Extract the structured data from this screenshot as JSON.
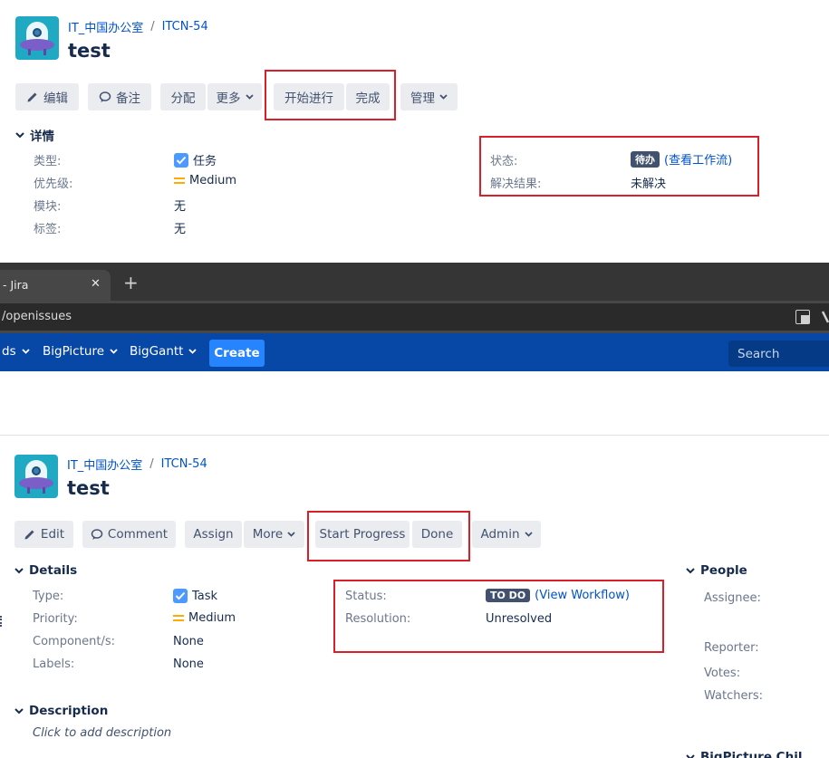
{
  "cn": {
    "breadcrumb": {
      "project": "IT_中国办公室",
      "separator": "/",
      "issue_key": "ITCN-54"
    },
    "title": "test",
    "toolbar": {
      "edit": "编辑",
      "comment": "备注",
      "assign": "分配",
      "more": "更多",
      "start_progress": "开始进行",
      "done": "完成",
      "admin": "管理"
    },
    "details": {
      "heading": "详情",
      "type_label": "类型:",
      "type_value": "任务",
      "priority_label": "优先级:",
      "priority_value": "Medium",
      "component_label": "模块:",
      "component_value": "无",
      "labels_label": "标签:",
      "labels_value": "无",
      "status_label": "状态:",
      "status_value": "待办",
      "workflow_link": "(查看工作流)",
      "resolution_label": "解决结果:",
      "resolution_value": "未解决"
    }
  },
  "browser": {
    "tab_title": "- Jira",
    "tab_close": "✕",
    "new_tab": "+",
    "address": "/openissues"
  },
  "nav": {
    "items": [
      "ds",
      "BigPicture",
      "BigGantt"
    ],
    "create": "Create",
    "search_placeholder": "Search"
  },
  "en": {
    "breadcrumb": {
      "project": "IT_中国办公室",
      "separator": "/",
      "issue_key": "ITCN-54"
    },
    "title": "test",
    "toolbar": {
      "edit": "Edit",
      "comment": "Comment",
      "assign": "Assign",
      "more": "More",
      "start_progress": "Start Progress",
      "done": "Done",
      "admin": "Admin"
    },
    "details": {
      "heading": "Details",
      "type_label": "Type:",
      "type_value": "Task",
      "priority_label": "Priority:",
      "priority_value": "Medium",
      "component_label": "Component/s:",
      "component_value": "None",
      "labels_label": "Labels:",
      "labels_value": "None",
      "status_label": "Status:",
      "status_value": "TO DO",
      "workflow_link": "(View Workflow)",
      "resolution_label": "Resolution:",
      "resolution_value": "Unresolved"
    },
    "people": {
      "heading": "People",
      "assignee_label": "Assignee:",
      "reporter_label": "Reporter:",
      "votes_label": "Votes:",
      "watchers_label": "Watchers:"
    },
    "description": {
      "heading": "Description",
      "placeholder": "Click to add description"
    },
    "cut_off_heading": "BigPicture Chil"
  },
  "colors": {
    "annotation_red": "#d9202a",
    "jira_nav": "#0747a6",
    "link": "#0052cc",
    "button_bg": "#ebecf0",
    "lozenge": "#42526e"
  }
}
